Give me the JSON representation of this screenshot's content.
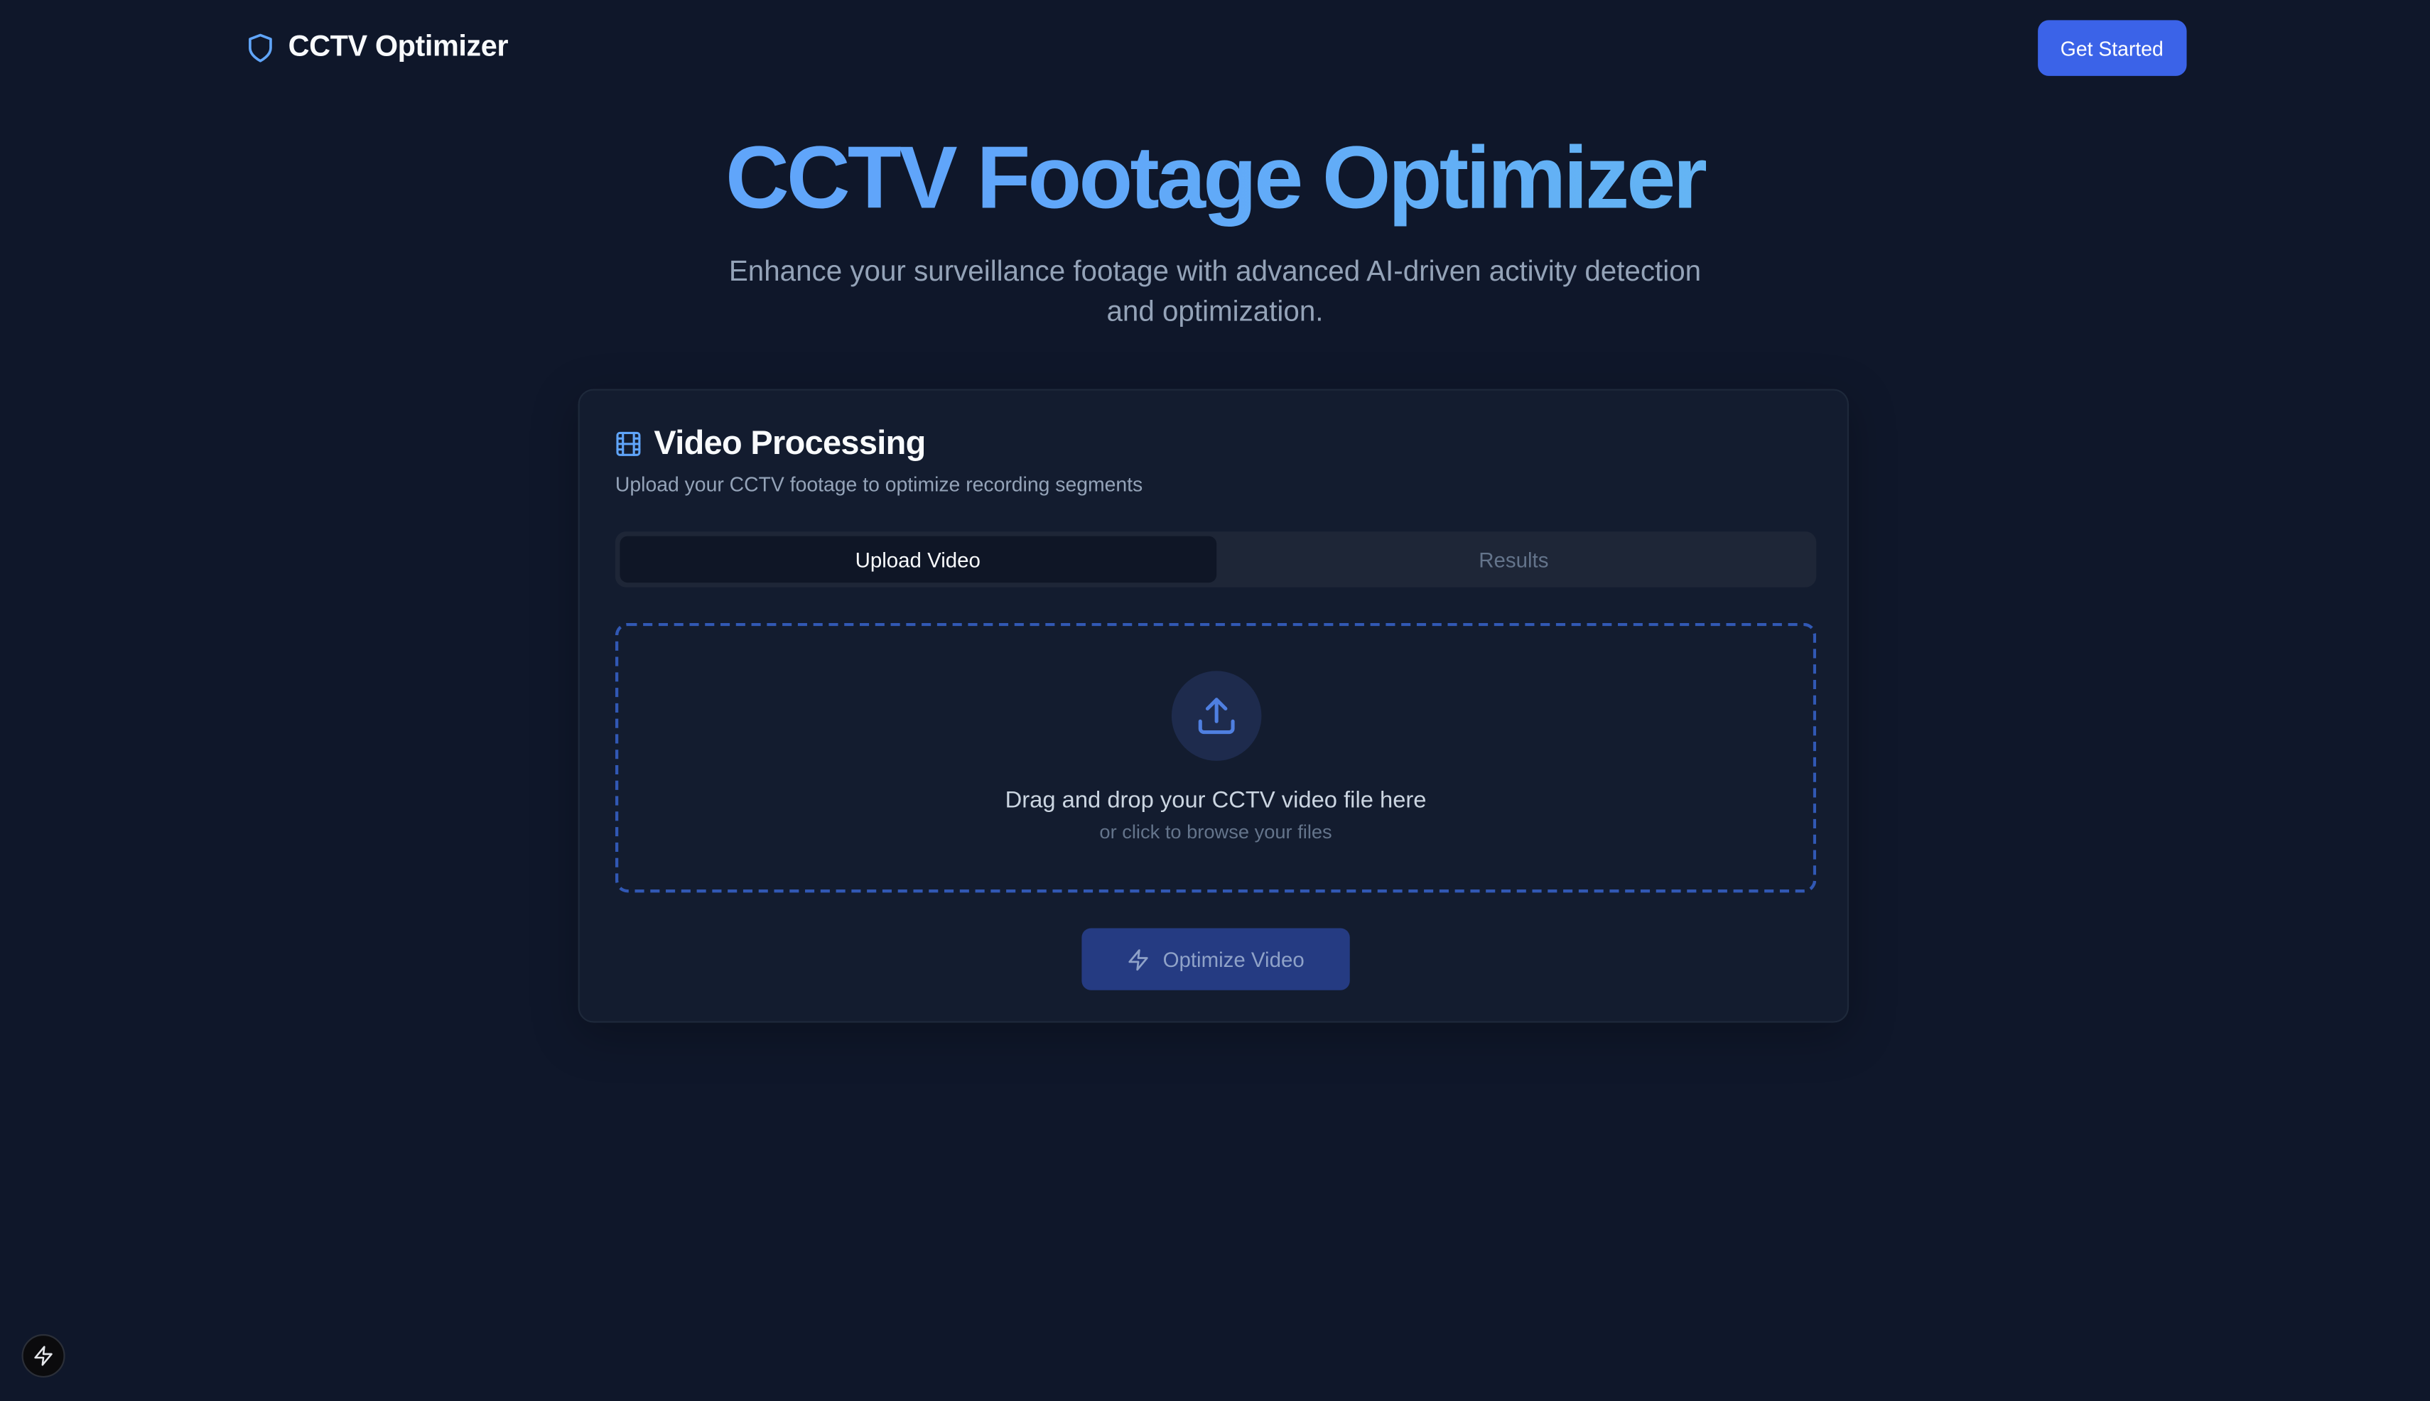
{
  "header": {
    "brand_name": "CCTV Optimizer",
    "brand_icon": "shield-icon",
    "cta_label": "Get Started"
  },
  "hero": {
    "title": "CCTV Footage Optimizer",
    "subtitle": "Enhance your surveillance footage with advanced AI-driven activity detection and optimization."
  },
  "card": {
    "icon": "film-icon",
    "title": "Video Processing",
    "description": "Upload your CCTV footage to optimize recording segments",
    "tabs": [
      {
        "label": "Upload Video",
        "active": true
      },
      {
        "label": "Results",
        "active": false
      }
    ],
    "dropzone": {
      "icon": "upload-icon",
      "primary_text": "Drag and drop your CCTV video file here",
      "secondary_text": "or click to browse your files"
    },
    "optimize_button": {
      "label": "Optimize Video",
      "icon": "lightning-icon",
      "disabled": true
    }
  },
  "corner_badge": {
    "icon": "lightning-icon"
  },
  "colors": {
    "background": "#0f172a",
    "card": "#131c2f",
    "accent": "#3b63e8",
    "title_gradient_start": "#60a5fa",
    "title_gradient_end": "#67c3ee",
    "dropzone_border": "#3158b4"
  }
}
